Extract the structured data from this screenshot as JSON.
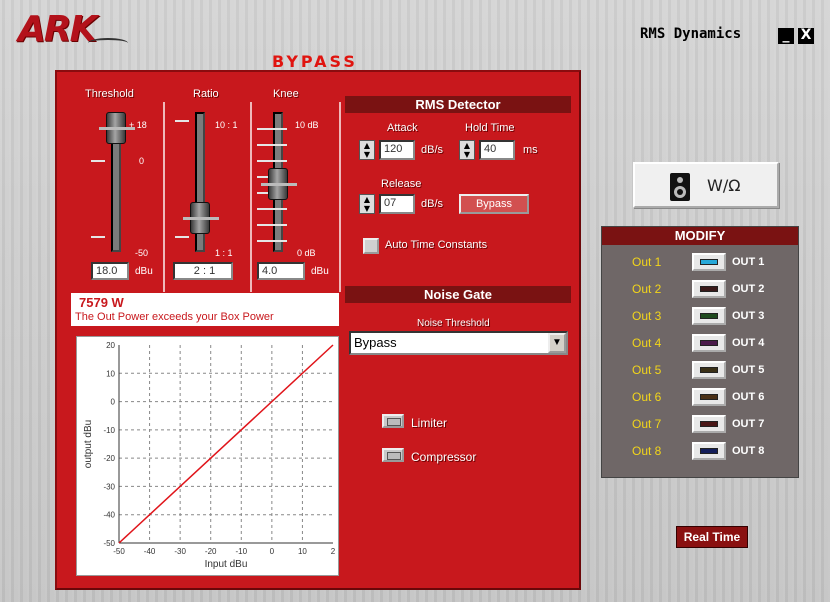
{
  "header": {
    "logo_text": "ARK",
    "app_title": "RMS Dynamics",
    "minimize": "_",
    "close": "X",
    "bypass_title": "BYPASS"
  },
  "sliders": {
    "threshold": {
      "label": "Threshold",
      "max": "+ 18",
      "mid": "0",
      "min": "-50",
      "value": "18.0",
      "unit": "dBu"
    },
    "ratio": {
      "label": "Ratio",
      "max": "10 : 1",
      "min": "1 : 1",
      "value": "2 : 1"
    },
    "knee": {
      "label": "Knee",
      "max": "10 dB",
      "min": "0 dB",
      "value": "4.0",
      "unit": "dBu"
    }
  },
  "power": {
    "value": "7579 W",
    "message": "The Out Power exceeds your Box Power"
  },
  "rms_detector": {
    "title": "RMS Detector",
    "attack_label": "Attack",
    "attack_value": "120",
    "attack_unit": "dB/s",
    "hold_label": "Hold Time",
    "hold_value": "40",
    "hold_unit": "ms",
    "release_label": "Release",
    "release_value": "07",
    "release_unit": "dB/s",
    "bypass_button": "Bypass",
    "auto_time": "Auto Time Constants"
  },
  "noise_gate": {
    "title": "Noise Gate",
    "threshold_label": "Noise Threshold",
    "selected": "Bypass"
  },
  "modes": {
    "limiter": "Limiter",
    "compressor": "Compressor"
  },
  "wo_button": "W/Ω",
  "modify": {
    "title": "MODIFY",
    "rows": [
      {
        "label": "Out 1",
        "out": "OUT 1",
        "color": "#27a8d8"
      },
      {
        "label": "Out 2",
        "out": "OUT 2",
        "color": "#3a1a1a"
      },
      {
        "label": "Out 3",
        "out": "OUT 3",
        "color": "#1e4a1e"
      },
      {
        "label": "Out 4",
        "out": "OUT 4",
        "color": "#4a1a4a"
      },
      {
        "label": "Out 5",
        "out": "OUT 5",
        "color": "#3a3016"
      },
      {
        "label": "Out 6",
        "out": "OUT 6",
        "color": "#4a3016"
      },
      {
        "label": "Out 7",
        "out": "OUT 7",
        "color": "#4a1616"
      },
      {
        "label": "Out 8",
        "out": "OUT 8",
        "color": "#141e5a"
      }
    ]
  },
  "realtime_button": "Real Time",
  "graph": {
    "xlabel": "Input dBu",
    "ylabel": "output dBu",
    "xticks": [
      "-50",
      "-40",
      "-30",
      "-20",
      "-10",
      "0",
      "10",
      "2"
    ],
    "yticks": [
      "20",
      "10",
      "0",
      "-10",
      "-20",
      "-30",
      "-40",
      "-50"
    ],
    "xlim": [
      -50,
      20
    ],
    "ylim": [
      -50,
      20
    ],
    "curve": [
      [
        -50,
        -50
      ],
      [
        20,
        20
      ]
    ]
  }
}
